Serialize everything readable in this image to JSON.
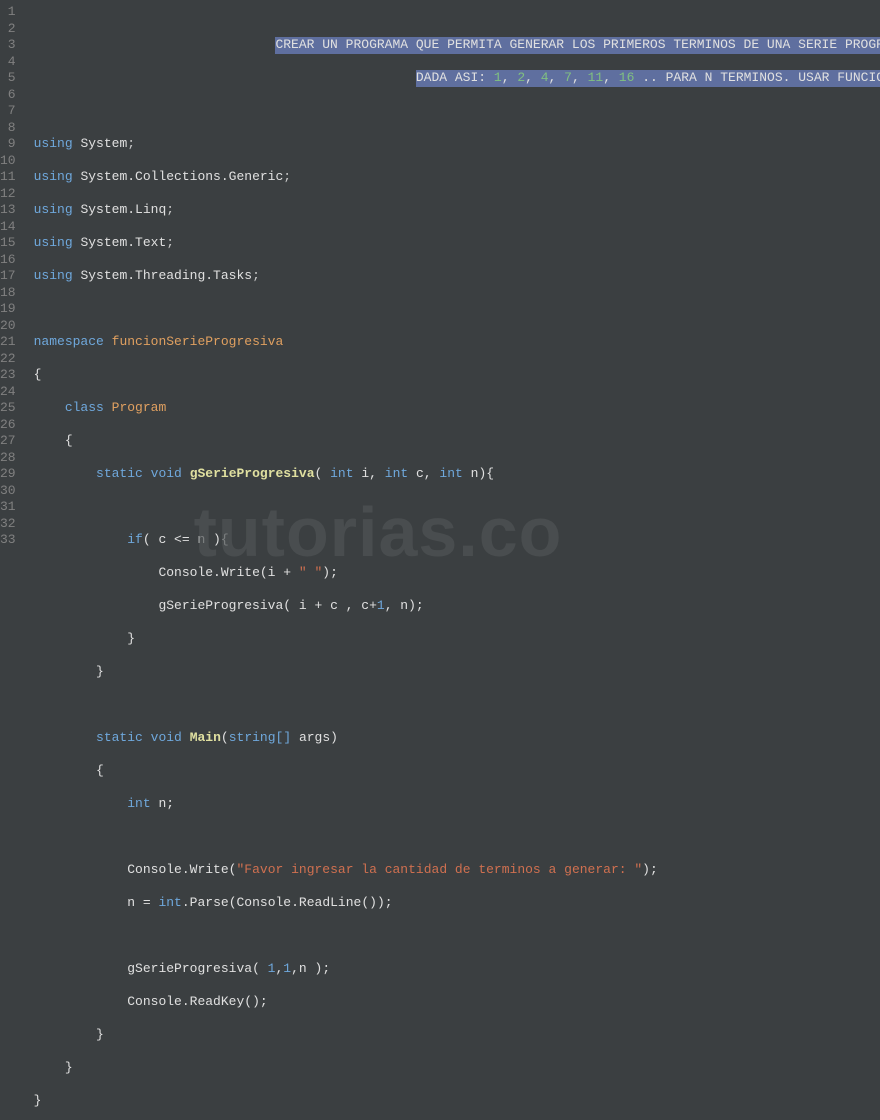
{
  "line_count": 33,
  "comment": {
    "line1_prefix": "CREAR UN PROGRAMA QUE PERMITA GENERAR LOS PRIMEROS TERMINOS DE UNA SERIE PROGRESIVA",
    "line2_prefix": "DADA ASI: ",
    "nums": [
      "1",
      "2",
      "4",
      "7",
      "11",
      "16"
    ],
    "line2_suffix": " .. PARA N TERMINOS. USAR FUNCION RECURSIVA"
  },
  "usings": [
    "System",
    "System.Collections.Generic",
    "System.Linq",
    "System.Text",
    "System.Threading.Tasks"
  ],
  "kw": {
    "using": "using",
    "namespace": "namespace",
    "class": "class",
    "static": "static",
    "void": "void",
    "int": "int",
    "if": "if",
    "string_arr": "string[]"
  },
  "id": {
    "ns": "funcionSerieProgresiva",
    "cls": "Program",
    "fn1": "gSerieProgresiva",
    "main": "Main",
    "args": "args",
    "i": "i",
    "c": "c",
    "n": "n",
    "console": "Console",
    "write": "Write",
    "readline": "ReadLine",
    "readkey": "ReadKey",
    "parse": "Parse",
    "int_cls": "int"
  },
  "str": {
    "space": "\" \"",
    "prompt": "\"Favor ingresar la cantidad de terminos a generar: \""
  },
  "num": {
    "one_a": "1",
    "one_b": "1",
    "one_c": "1"
  },
  "watermark": "tutorias.co"
}
